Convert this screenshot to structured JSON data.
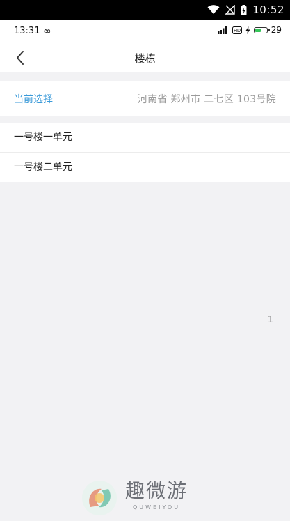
{
  "system_status": {
    "time": "10:52"
  },
  "app_status": {
    "time": "13:31",
    "battery_level": "29"
  },
  "header": {
    "title": "楼栋"
  },
  "selection": {
    "label": "当前选择",
    "value": "河南省 郑州市 二七区 103号院"
  },
  "buildings": [
    {
      "label": "一号楼一单元"
    },
    {
      "label": "一号楼二单元"
    }
  ],
  "page_index": "1",
  "watermark": {
    "text_cn": "趣微游",
    "text_en": "QUWEIYOU"
  },
  "colors": {
    "accent": "#3a9ad9",
    "background": "#f2f2f4"
  }
}
